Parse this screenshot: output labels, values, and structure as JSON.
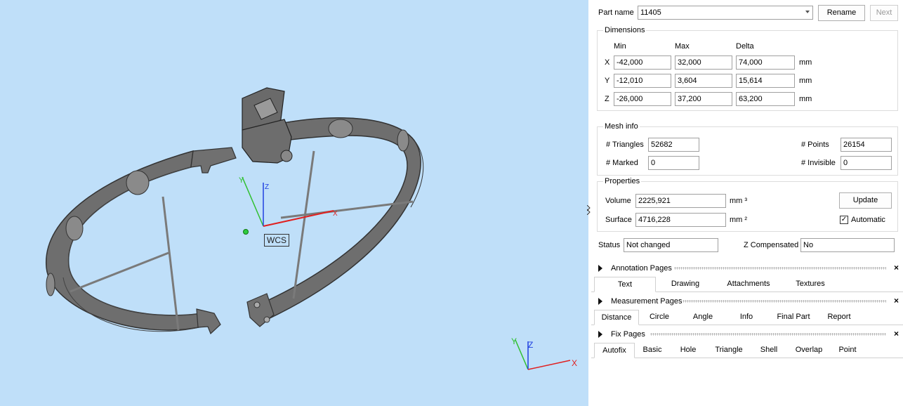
{
  "viewport": {
    "wcs_label": "WCS",
    "axis_labels": {
      "x": "X",
      "y": "Y",
      "z": "Z"
    },
    "colors": {
      "background": "#bfdff9",
      "part": "#6b6b6b",
      "x_axis": "#e02020",
      "y_axis": "#30c030",
      "z_axis": "#2040e0"
    }
  },
  "part": {
    "name_label": "Part name",
    "name_value": "11405",
    "rename_button": "Rename",
    "next_button": "Next"
  },
  "dimensions": {
    "title": "Dimensions",
    "col_min": "Min",
    "col_max": "Max",
    "col_delta": "Delta",
    "rows": [
      {
        "axis": "X",
        "min": "-42,000",
        "max": "32,000",
        "delta": "74,000",
        "unit": "mm"
      },
      {
        "axis": "Y",
        "min": "-12,010",
        "max": "3,604",
        "delta": "15,614",
        "unit": "mm"
      },
      {
        "axis": "Z",
        "min": "-26,000",
        "max": "37,200",
        "delta": "63,200",
        "unit": "mm"
      }
    ]
  },
  "mesh_info": {
    "title": "Mesh info",
    "triangles_label": "# Triangles",
    "triangles_value": "52682",
    "points_label": "# Points",
    "points_value": "26154",
    "marked_label": "# Marked",
    "marked_value": "0",
    "invisible_label": "# Invisible",
    "invisible_value": "0"
  },
  "properties": {
    "title": "Properties",
    "volume_label": "Volume",
    "volume_value": "2225,921",
    "volume_unit": "mm ³",
    "surface_label": "Surface",
    "surface_value": "4716,228",
    "surface_unit": "mm ²",
    "update_button": "Update",
    "automatic_label": "Automatic",
    "automatic_checked": true
  },
  "status": {
    "status_label": "Status",
    "status_value": "Not changed",
    "zcomp_label": "Z Compensated",
    "zcomp_value": "No"
  },
  "sections": [
    {
      "title": "Annotation Pages",
      "close": "×",
      "tabs": [
        "Text",
        "Drawing",
        "Attachments",
        "Textures"
      ],
      "active": 0
    },
    {
      "title": "Measurement Pages",
      "close": "×",
      "tabs": [
        "Distance",
        "Circle",
        "Angle",
        "Info",
        "Final Part",
        "Report"
      ],
      "active": 0
    },
    {
      "title": "Fix Pages",
      "close": "×",
      "tabs": [
        "Autofix",
        "Basic",
        "Hole",
        "Triangle",
        "Shell",
        "Overlap",
        "Point"
      ],
      "active": 0
    }
  ]
}
